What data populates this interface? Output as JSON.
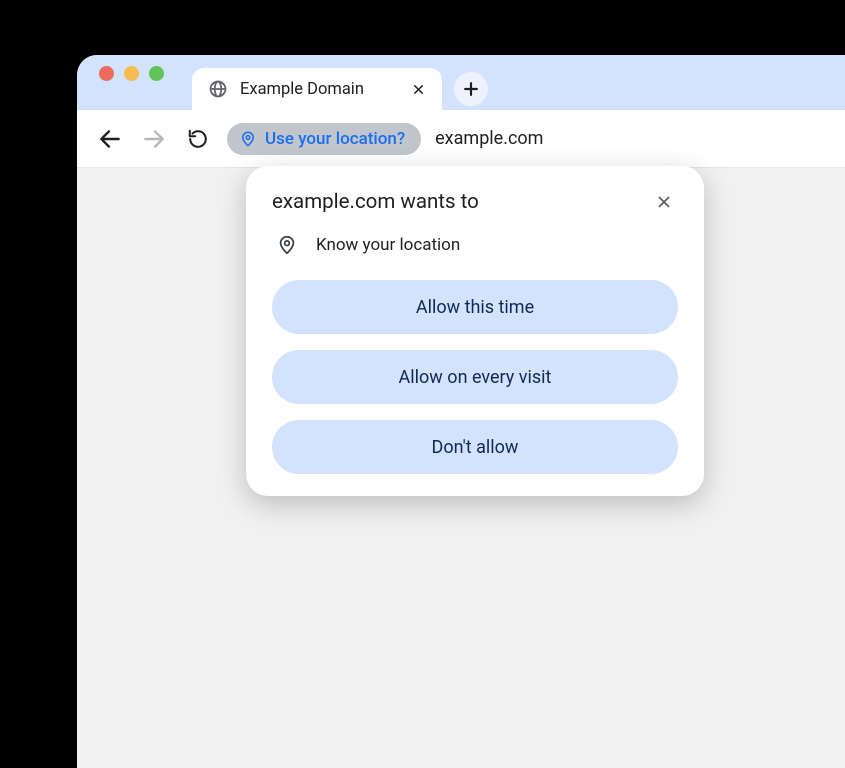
{
  "tab": {
    "title": "Example Domain"
  },
  "toolbar": {
    "permission_chip": "Use your location?",
    "url": "example.com"
  },
  "popover": {
    "title": "example.com wants to",
    "permission_label": "Know your location",
    "buttons": {
      "allow_once": "Allow this time",
      "allow_always": "Allow on every visit",
      "deny": "Don't allow"
    }
  }
}
